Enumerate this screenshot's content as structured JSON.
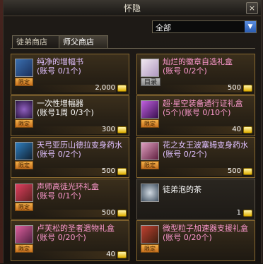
{
  "window": {
    "title": "怀隐",
    "close": "×"
  },
  "filter": {
    "selected": "全部",
    "arrow": "▼"
  },
  "tabs": [
    {
      "label": "徒弟商店"
    },
    {
      "label": "师父商店"
    }
  ],
  "items": [
    {
      "name": "纯净的增幅书",
      "limit": "(账号 0/1个)",
      "badge": "限定",
      "price": "2,000",
      "name_color": "#e0c0ff",
      "icon": "book-icon"
    },
    {
      "name": "灿烂的徽章自选礼盒",
      "limit": "(账号 0/2个)",
      "badge": "目录",
      "price": "500",
      "name_color": "#ff9ad0",
      "icon": "box-icon"
    },
    {
      "name": "一次性增幅器",
      "limit": "(账号1周 0/3个)",
      "badge": "限定",
      "price": "300",
      "name_color": "#ffffff",
      "icon": "amplifier-icon"
    },
    {
      "name": "超·星空装备通行证礼盒",
      "limit": "(5个)(账号 0/10个)",
      "badge": "限定",
      "price": "40",
      "name_color": "#ff9ad0",
      "icon": "star-box-icon"
    },
    {
      "name": "天弓亚历山德拉变身药水",
      "limit": "(账号 0/2个)",
      "badge": "限定",
      "price": "500",
      "name_color": "#e0c0ff",
      "icon": "potion-icon"
    },
    {
      "name": "花之女王波塞姆变身药水",
      "limit": "(账号 0/2个)",
      "badge": "限定",
      "price": "500",
      "name_color": "#e0c0ff",
      "icon": "potion-icon"
    },
    {
      "name": "声师高徒光环礼盒",
      "limit": "(账号 0/1个)",
      "badge": "限定",
      "price": "500",
      "name_color": "#ff9ad0",
      "icon": "aura-box-icon"
    },
    {
      "name": "徒弟泡的茶",
      "limit": "",
      "badge": "",
      "price": "1",
      "name_color": "#ffffff",
      "icon": "tea-icon"
    },
    {
      "name": "卢芙松的圣者遗物礼盒",
      "limit": "(账号 0/20个)",
      "badge": "限定",
      "price": "40",
      "name_color": "#ff9ad0",
      "icon": "relic-box-icon"
    },
    {
      "name": "微型粒子加速器支援礼盒",
      "limit": "(账号 0/20个)",
      "badge": "限定",
      "price": "",
      "name_color": "#ff9ad0",
      "icon": "accelerator-box-icon"
    }
  ]
}
